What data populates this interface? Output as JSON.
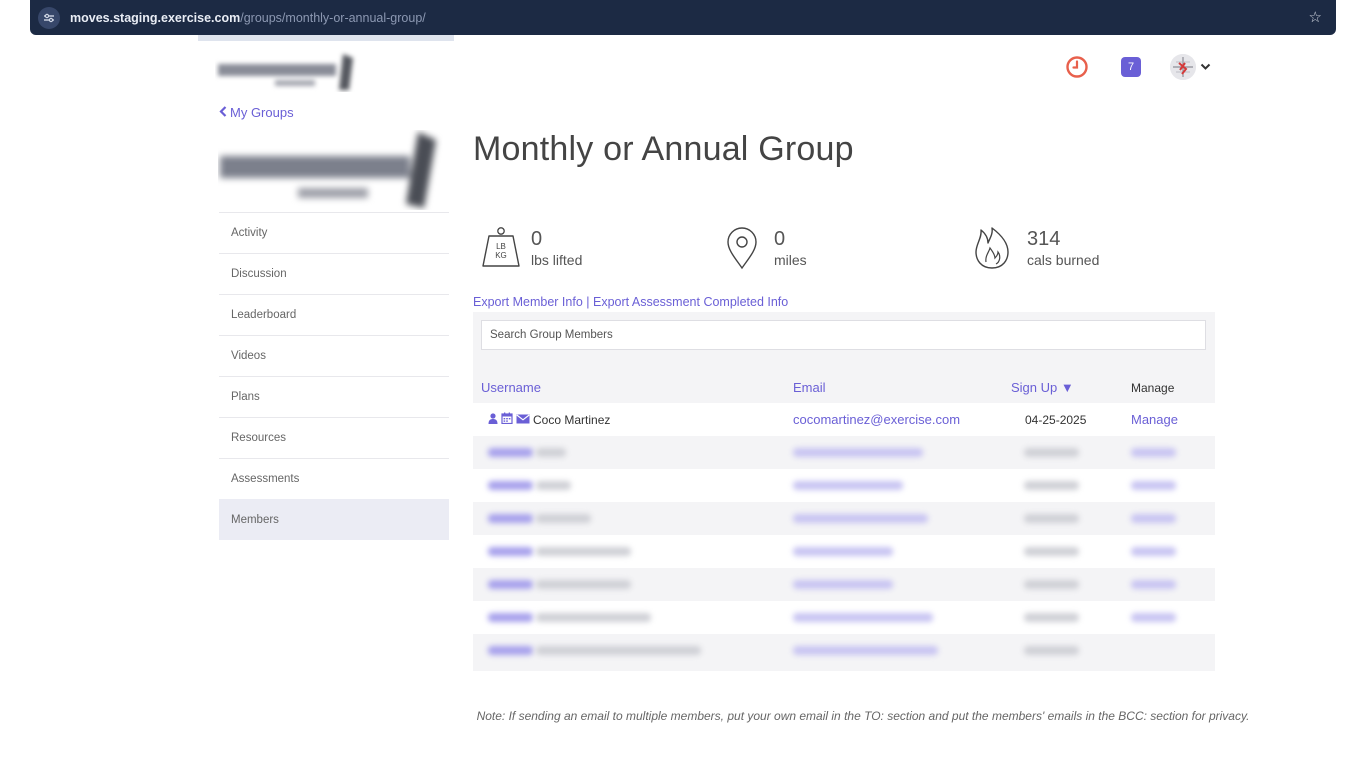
{
  "browser": {
    "url_host": "moves.staging.exercise.com",
    "url_path": "/groups/monthly-or-annual-group/"
  },
  "sidebar": {
    "back_label": "My Groups",
    "items": [
      {
        "label": "Activity"
      },
      {
        "label": "Discussion"
      },
      {
        "label": "Leaderboard"
      },
      {
        "label": "Videos"
      },
      {
        "label": "Plans"
      },
      {
        "label": "Resources"
      },
      {
        "label": "Assessments"
      },
      {
        "label": "Members",
        "active": true
      }
    ]
  },
  "header": {
    "notification_count": "7"
  },
  "main": {
    "title": "Monthly or Annual Group",
    "stats": [
      {
        "value": "0",
        "label": "lbs lifted",
        "icon": "weight-icon",
        "icon_text_top": "LB",
        "icon_text_bottom": "KG"
      },
      {
        "value": "0",
        "label": "miles",
        "icon": "map-pin-icon"
      },
      {
        "value": "314",
        "label": "cals burned",
        "icon": "flame-icon"
      }
    ],
    "export_member_label": "Export Member Info",
    "export_separator": "|",
    "export_assessment_label": "Export Assessment Completed Info",
    "search_placeholder": "Search Group Members",
    "columns": {
      "username": "Username",
      "email": "Email",
      "signup": "Sign Up ▼",
      "manage": "Manage"
    },
    "first_row": {
      "username": "Coco Martinez",
      "email": "cocomartinez@exercise.com",
      "signup": "04-25-2025",
      "manage": "Manage"
    },
    "note": "Note: If sending an email to multiple members, put your own email in the TO: section and put the members' emails in the BCC: section for privacy."
  },
  "colors": {
    "accent": "#6a5fd6",
    "clock": "#e8604c",
    "url_bar": "#1c2a44"
  }
}
